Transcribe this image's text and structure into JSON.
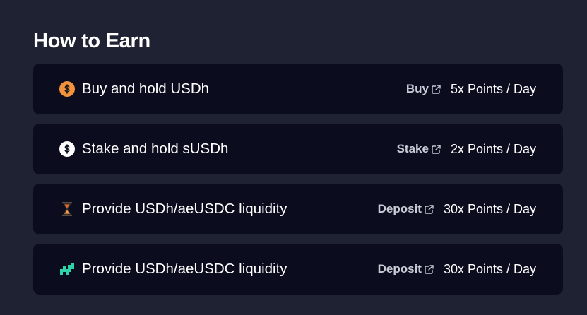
{
  "section": {
    "title": "How to Earn"
  },
  "rows": [
    {
      "label": "Buy and hold USDh",
      "action": "Buy",
      "points": "5x Points / Day",
      "icon": "usdh-coin-icon",
      "icon_color": "#f2923c"
    },
    {
      "label": "Stake and hold sUSDh",
      "action": "Stake",
      "points": "2x Points / Day",
      "icon": "susdh-coin-icon",
      "icon_color": "#ffffff"
    },
    {
      "label": "Provide USDh/aeUSDC liquidity",
      "action": "Deposit",
      "points": "30x Points / Day",
      "icon": "hourglass-protocol-icon",
      "icon_color": "#e06a2c"
    },
    {
      "label": "Provide USDh/aeUSDC liquidity",
      "action": "Deposit",
      "points": "30x Points / Day",
      "icon": "teal-protocol-icon",
      "icon_color": "#2ed3a7"
    }
  ]
}
